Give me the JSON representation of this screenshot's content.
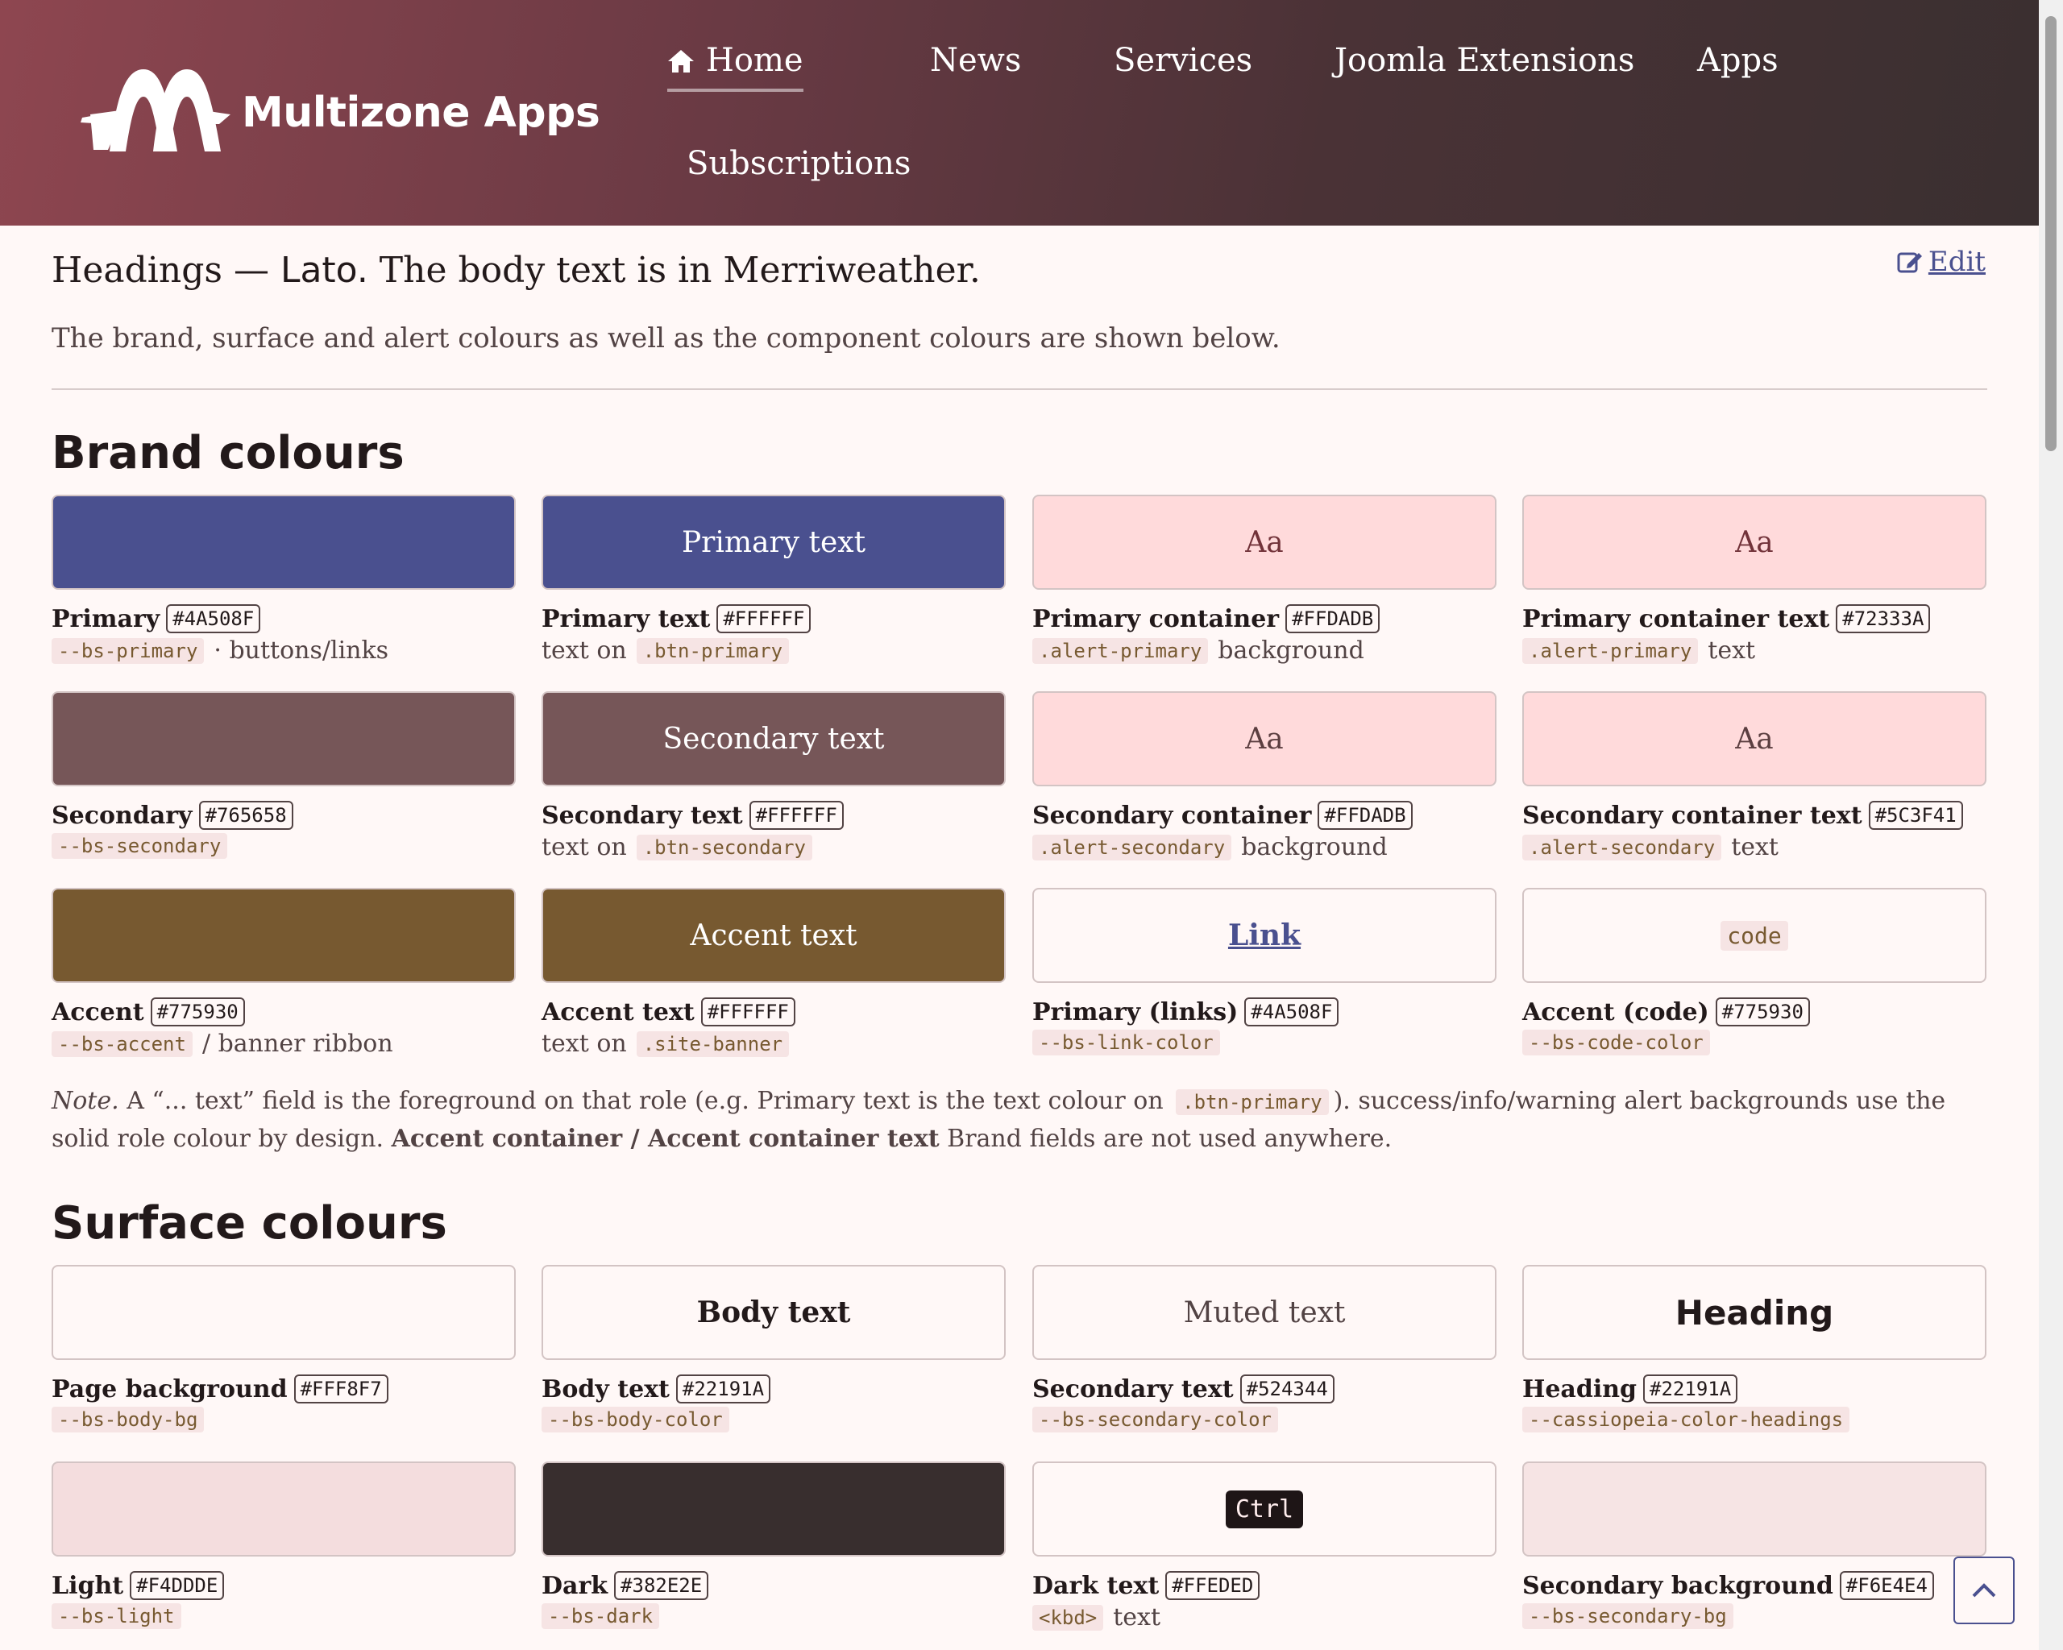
{
  "header": {
    "brand": "Multizone Apps",
    "nav": [
      {
        "label": "Home",
        "active": true
      },
      {
        "label": "News"
      },
      {
        "label": "Services"
      },
      {
        "label": "Joomla Extensions"
      },
      {
        "label": "Apps"
      },
      {
        "label": "Subscriptions"
      }
    ]
  },
  "intro": {
    "prefix": "Headings — ",
    "heading_font": "Lato.",
    "suffix": " The body text is in Merriweather.",
    "edit_label": "Edit",
    "description": "The brand, surface and alert colours as well as the component colours are shown below."
  },
  "brand_section": {
    "title": "Brand colours",
    "swatches": [
      {
        "sample": "",
        "bg": "#4A508F",
        "name": "Primary",
        "hex": "#4A508F",
        "code": "--bs-primary",
        "desc": "· buttons/links"
      },
      {
        "sample": "Primary text",
        "bg": "#4A508F",
        "fg": "#FFFFFF",
        "name": "Primary text",
        "hex": "#FFFFFF",
        "pre": "text on",
        "code": ".btn-primary"
      },
      {
        "sample": "Aa",
        "bg": "#FFDADB",
        "fg": "#72333A",
        "name": "Primary container",
        "hex": "#FFDADB",
        "code": ".alert-primary",
        "desc": "background"
      },
      {
        "sample": "Aa",
        "bg": "#FFDADB",
        "fg": "#72333A",
        "name": "Primary container text",
        "hex": "#72333A",
        "code": ".alert-primary",
        "desc": "text"
      },
      {
        "sample": "",
        "bg": "#765658",
        "name": "Secondary",
        "hex": "#765658",
        "code": "--bs-secondary"
      },
      {
        "sample": "Secondary text",
        "bg": "#765658",
        "fg": "#FFFFFF",
        "name": "Secondary text",
        "hex": "#FFFFFF",
        "pre": "text on",
        "code": ".btn-secondary"
      },
      {
        "sample": "Aa",
        "bg": "#FFDADB",
        "fg": "#5C3F41",
        "name": "Secondary container",
        "hex": "#FFDADB",
        "code": ".alert-secondary",
        "desc": "background"
      },
      {
        "sample": "Aa",
        "bg": "#FFDADB",
        "fg": "#5C3F41",
        "name": "Secondary container text",
        "hex": "#5C3F41",
        "code": ".alert-secondary",
        "desc": "text"
      },
      {
        "sample": "",
        "bg": "#775930",
        "name": "Accent",
        "hex": "#775930",
        "code": "--bs-accent",
        "desc": "/ banner ribbon"
      },
      {
        "sample": "Accent text",
        "bg": "#775930",
        "fg": "#FFFFFF",
        "name": "Accent text",
        "hex": "#FFFFFF",
        "pre": "text on",
        "code": ".site-banner"
      },
      {
        "sample": "Link",
        "bg": "#FFF8F7",
        "fg": "#4A508F",
        "name": "Primary (links)",
        "hex": "#4A508F",
        "code": "--bs-link-color"
      },
      {
        "sample": "code",
        "bg": "#FFF8F7",
        "fg": "#775930",
        "name": "Accent (code)",
        "hex": "#775930",
        "code": "--bs-code-color"
      }
    ],
    "note": {
      "lead": "Note.",
      "t1": " A “... text” field is the foreground on that role (e.g. Primary text is the text colour on ",
      "code": ".btn-primary",
      "t2": "). success/info/warning alert backgrounds use the solid role colour by design. ",
      "bold": "Accent container / Accent container text",
      "t3": " Brand fields are not used anywhere."
    }
  },
  "surface_section": {
    "title": "Surface colours",
    "swatches": [
      {
        "sample": "",
        "bg": "#FFF8F7",
        "name": "Page background",
        "hex": "#FFF8F7",
        "code": "--bs-body-bg"
      },
      {
        "sample": "Body text",
        "bg": "#FFF8F7",
        "fg": "#22191A",
        "name": "Body text",
        "hex": "#22191A",
        "code": "--bs-body-color"
      },
      {
        "sample": "Muted text",
        "bg": "#FFF8F7",
        "fg": "#524344",
        "name": "Secondary text",
        "hex": "#524344",
        "code": "--bs-secondary-color"
      },
      {
        "sample": "Heading",
        "bg": "#FFF8F7",
        "fg": "#22191A",
        "name": "Heading",
        "hex": "#22191A",
        "code": "--cassiopeia-color-headings"
      },
      {
        "sample": "",
        "bg": "#F4DDDE",
        "name": "Light",
        "hex": "#F4DDDE",
        "code": "--bs-light"
      },
      {
        "sample": "",
        "bg": "#382E2E",
        "name": "Dark",
        "hex": "#382E2E",
        "code": "--bs-dark"
      },
      {
        "sample": "Ctrl",
        "bg": "#FFF8F7",
        "name": "Dark text",
        "hex": "#FFEDED",
        "code": "<kbd>",
        "desc": "text"
      },
      {
        "sample": "",
        "bg": "#F6E4E4",
        "name": "Secondary background",
        "hex": "#F6E4E4",
        "code": "--bs-secondary-bg"
      }
    ]
  },
  "icons": {
    "home": "home-icon",
    "edit": "edit-icon",
    "back_to_top": "chevron-up-icon"
  }
}
